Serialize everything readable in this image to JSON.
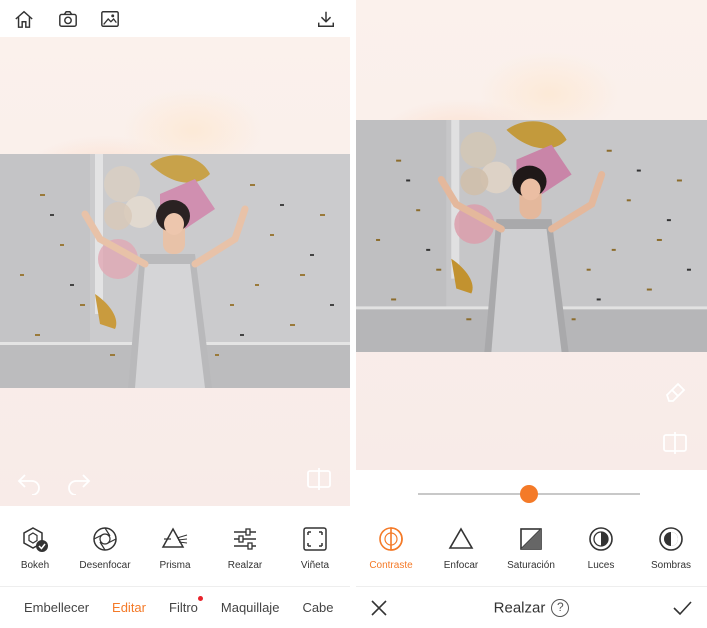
{
  "left": {
    "top_icons": [
      "home-icon",
      "camera-icon",
      "image-edit-icon",
      "download-icon"
    ],
    "tools": [
      {
        "label": "Bokeh",
        "icon": "bokeh-hexagon-icon"
      },
      {
        "label": "Desenfocar",
        "icon": "aperture-icon"
      },
      {
        "label": "Prisma",
        "icon": "prism-icon"
      },
      {
        "label": "Realzar",
        "icon": "sliders-icon"
      },
      {
        "label": "Viñeta",
        "icon": "vignette-frame-icon"
      }
    ],
    "tabs": [
      {
        "label": "Embellecer",
        "active": false
      },
      {
        "label": "Editar",
        "active": true
      },
      {
        "label": "Filtro",
        "active": false,
        "badge": true
      },
      {
        "label": "Maquillaje",
        "active": false
      },
      {
        "label": "Cabe",
        "active": false
      }
    ]
  },
  "right": {
    "slider": {
      "value": 0.5
    },
    "tools": [
      {
        "label": "Contraste",
        "icon": "contrast-icon",
        "active": true
      },
      {
        "label": "Enfocar",
        "icon": "triangle-sharpen-icon",
        "active": false
      },
      {
        "label": "Saturación",
        "icon": "saturation-square-icon",
        "active": false
      },
      {
        "label": "Luces",
        "icon": "highlights-circle-icon",
        "active": false
      },
      {
        "label": "Sombras",
        "icon": "shadows-circle-icon",
        "active": false
      }
    ],
    "bottom": {
      "title": "Realzar",
      "help": "?"
    }
  },
  "colors": {
    "accent": "#f47a28",
    "text": "#333333",
    "badge": "#e8232b"
  }
}
